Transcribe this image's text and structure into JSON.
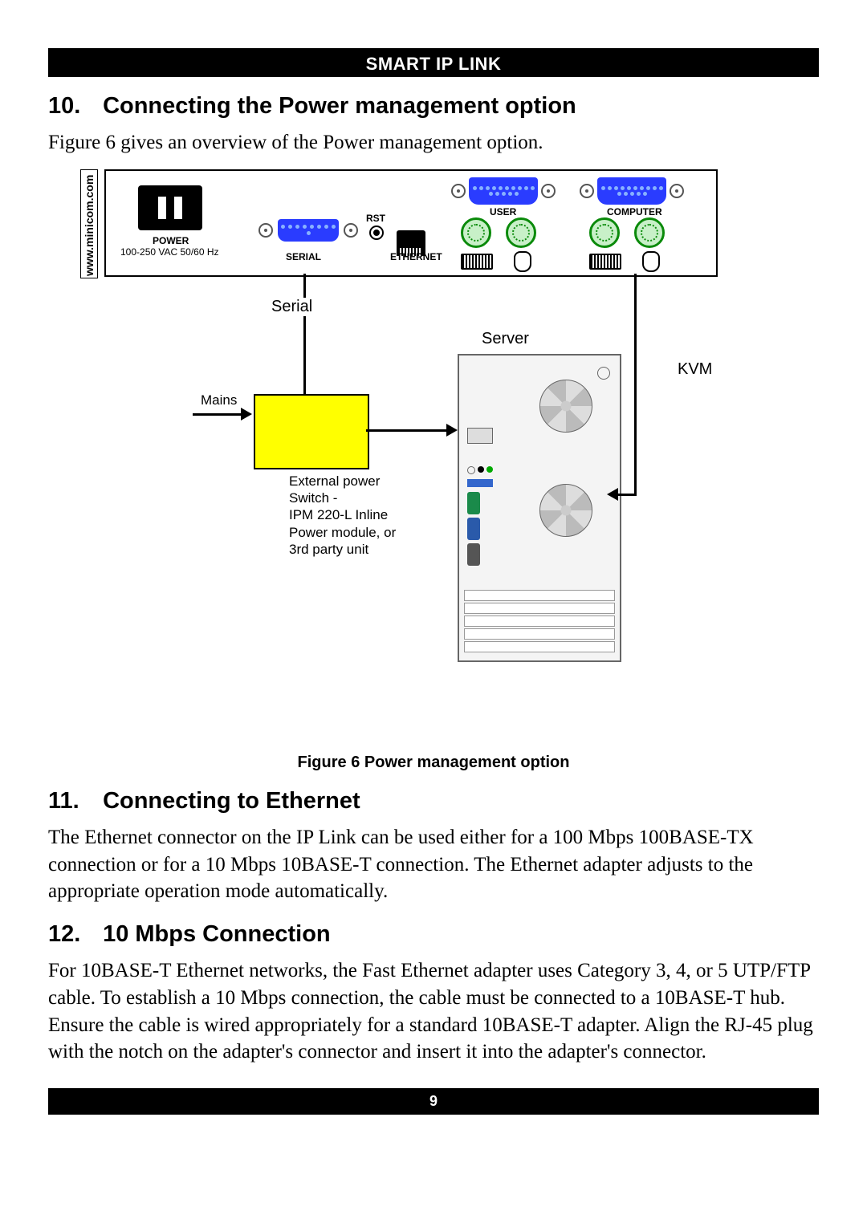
{
  "header": {
    "title": "SMART IP LINK"
  },
  "sections": {
    "s10": {
      "num": "10.",
      "title": "Connecting the Power management option",
      "p1": "Figure 6 gives an overview of the Power management option."
    },
    "s11": {
      "num": "11.",
      "title": "Connecting to Ethernet",
      "p1": "The Ethernet connector on the IP Link can be used either for a 100 Mbps 100BASE-TX connection or for a 10 Mbps 10BASE-T connection. The Ethernet adapter adjusts to the appropriate operation mode automatically."
    },
    "s12": {
      "num": "12.",
      "title": "10 Mbps Connection",
      "p1": "For 10BASE-T Ethernet networks, the Fast Ethernet adapter uses Category 3, 4, or 5 UTP/FTP cable. To establish a 10 Mbps connection, the cable must be connected to a 10BASE-T hub. Ensure the cable is wired appropriately for a standard 10BASE-T adapter. Align the RJ-45 plug with the notch on the adapter's connector and insert it into the adapter's connector."
    }
  },
  "figure": {
    "caption": "Figure 6 Power management option",
    "labels": {
      "brand": "www.minicom.com",
      "power": "POWER",
      "power_sub": "100-250 VAC 50/60 Hz",
      "serial_port": "SERIAL",
      "rst": "RST",
      "ethernet": "ETHERNET",
      "user": "USER",
      "computer": "COMPUTER",
      "serial": "Serial",
      "server": "Server",
      "kvm": "KVM",
      "mains": "Mains",
      "ext1": "External power",
      "ext2": "Switch -",
      "ext3": "IPM 220-L Inline",
      "ext4": "Power module, or",
      "ext5": "3rd party unit"
    }
  },
  "footer": {
    "page": "9"
  }
}
